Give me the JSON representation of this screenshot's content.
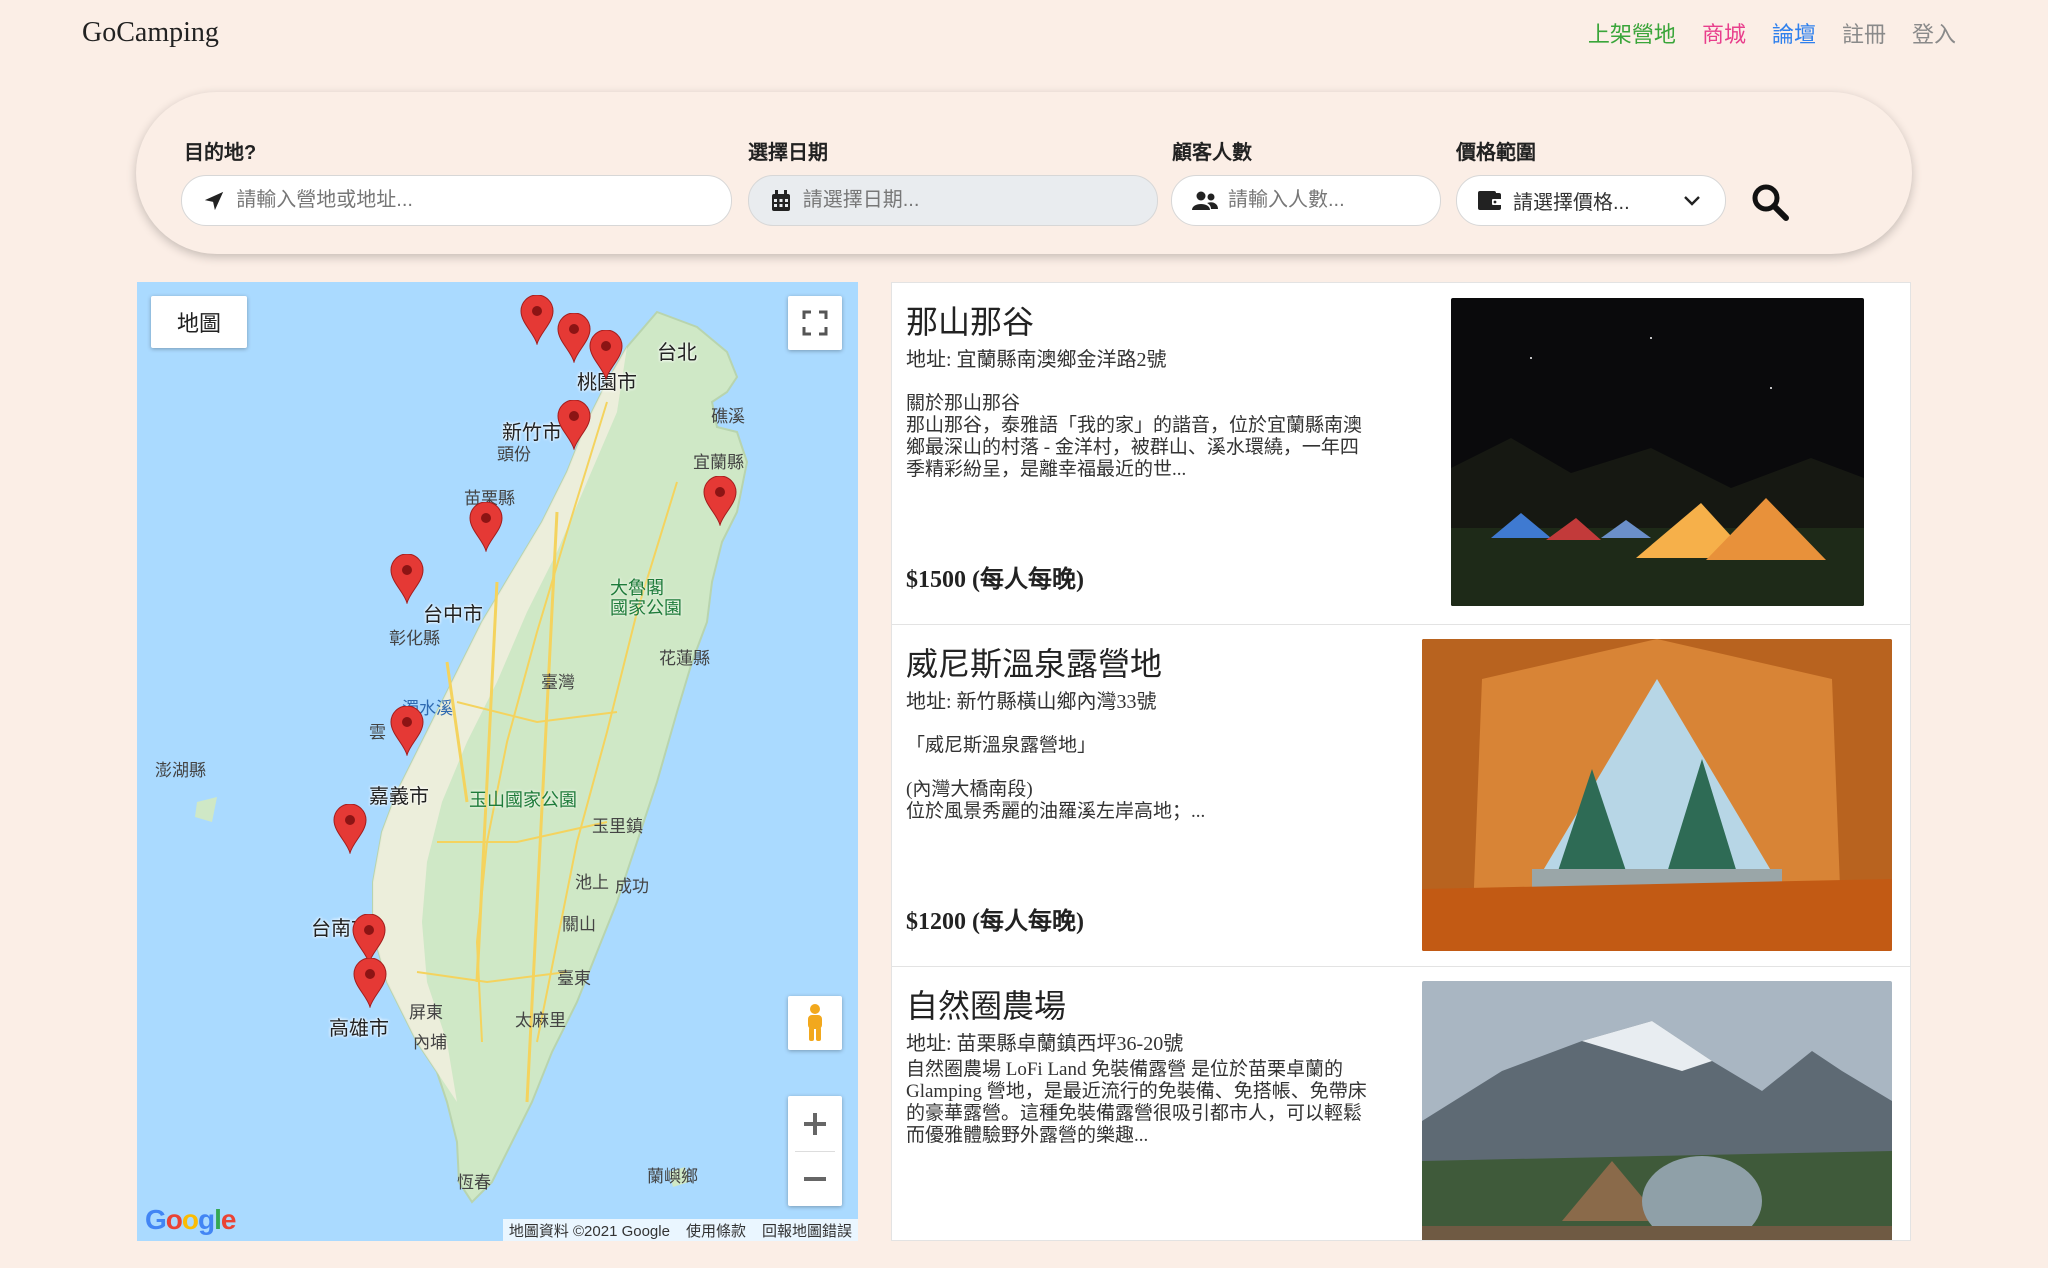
{
  "brand": "GoCamping",
  "nav": {
    "list_camp": "上架營地",
    "shop": "商城",
    "forum": "論壇",
    "signup": "註冊",
    "login": "登入"
  },
  "search": {
    "destination_label": "目的地?",
    "destination_placeholder": "請輸入營地或地址...",
    "date_label": "選擇日期",
    "date_placeholder": "請選擇日期...",
    "guests_label": "顧客人數",
    "guests_placeholder": "請輸入人數...",
    "price_label": "價格範圍",
    "price_selected": "請選擇價格...",
    "search_icon": "search-icon"
  },
  "map": {
    "type_button": "地圖",
    "attribution": "地圖資料 ©2021 Google",
    "terms": "使用條款",
    "report": "回報地圖錯誤",
    "google_logo": "Google",
    "labels": {
      "taipei": "台北",
      "taoyuan": "桃園市",
      "hsinchu": "新竹市",
      "toufen": "頭份",
      "miaoli": "苗栗縣",
      "keelung_su": "礁溪",
      "yilan": "宜蘭縣",
      "taichung": "台中市",
      "changhua": "彰化縣",
      "taroko": "大魯閣\n國家公園",
      "hualien": "花蓮縣",
      "taiwan": "臺灣",
      "zhuoshui": "濁水溪",
      "yunlin": "雲",
      "penghu": "澎湖縣",
      "chiayi": "嘉義市",
      "yushan": "玉山國家公園",
      "yuli": "玉里鎮",
      "chishang": "池上",
      "chenggong": "成功",
      "guanshan": "關山",
      "tainan": "台南市",
      "taitung": "臺東",
      "kaohsiung": "高雄市",
      "pingtung": "屏東",
      "neipu": "內埔",
      "damali": "太麻里",
      "hengchun": "恆春",
      "lanyu": "蘭嶼鄉"
    }
  },
  "camps": [
    {
      "title": "那山那谷",
      "address": "地址: 宜蘭縣南澳鄉金洋路2號",
      "description": "關於那山那谷\n那山那谷，泰雅語「我的家」的諧音，位於宜蘭縣南澳鄉最深山的村落 - 金洋村，被群山、溪水環繞，一年四季精彩紛呈，是離幸福最近的世...",
      "price": "$1500 (每人每晚)"
    },
    {
      "title": "威尼斯溫泉露營地",
      "address": "地址: 新竹縣橫山鄉內灣33號",
      "description": "「威尼斯溫泉露營地」\n\n(內灣大橋南段)\n位於風景秀麗的油羅溪左岸高地；...",
      "price": "$1200 (每人每晚)"
    },
    {
      "title": "自然圈農場",
      "address": "地址: 苗栗縣卓蘭鎮西坪36-20號",
      "description": "自然圈農場 LoFi Land 免裝備露營 是位於苗栗卓蘭的 Glamping 營地，是最近流行的免裝備、免搭帳、免帶床的豪華露營。這種免裝備露營很吸引都市人，可以輕鬆而優雅體驗野外露營的樂趣...",
      "price": ""
    }
  ]
}
